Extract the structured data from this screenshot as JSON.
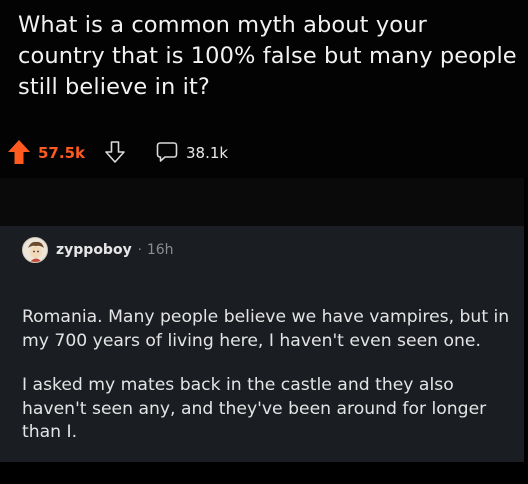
{
  "post": {
    "title": "What is a common myth about your country that is 100% false but many people still believe in it?",
    "score": "57.5k",
    "comments_count": "38.1k"
  },
  "comment": {
    "username": "zyppoboy",
    "separator": "·",
    "age": "16h",
    "paragraphs": [
      "Romania. Many people believe we have vampires, but in my 700 years of living here, I haven't even seen one.",
      "I asked my mates back in the castle and they also haven't seen any, and they've been around for longer than I."
    ]
  },
  "colors": {
    "upvote_accent": "#ff5a1f",
    "comment_background": "#1a1d22",
    "page_background": "#000000"
  },
  "icons": [
    "upvote-arrow-icon",
    "downvote-arrow-icon",
    "comment-bubble-icon",
    "avatar-icon"
  ]
}
